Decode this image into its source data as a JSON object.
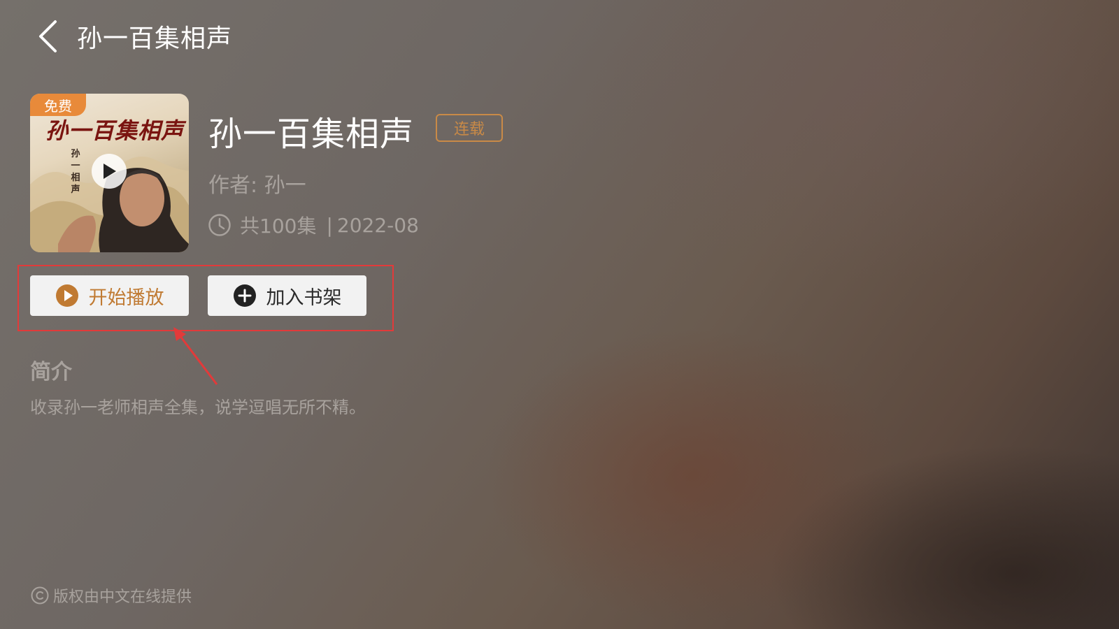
{
  "header": {
    "back_icon": "chevron-left-icon",
    "title": "孙一百集相声"
  },
  "cover": {
    "badge": "免费",
    "title": "孙一百集相声",
    "vertical_text": "孙一相声",
    "play_icon": "play-icon"
  },
  "book": {
    "title": "孙一百集相声",
    "status": "连载",
    "author": "作者: 孙一",
    "episodes": "共100集",
    "separator": "|",
    "date": "2022-08",
    "clock_icon": "clock-icon"
  },
  "actions": {
    "play_label": "开始播放",
    "play_icon": "play-circle-icon",
    "shelf_label": "加入书架",
    "shelf_icon": "plus-circle-icon"
  },
  "intro": {
    "heading": "简介",
    "text": "收录孙一老师相声全集，说学逗唱无所不精。"
  },
  "footer": {
    "copyright_icon": "copyright-icon",
    "copyright": "版权由中文在线提供"
  },
  "colors": {
    "accent": "#c98a47",
    "badge": "#e88a3a",
    "annotation": "#e23a3a",
    "muted_text": "#a8a29d"
  }
}
